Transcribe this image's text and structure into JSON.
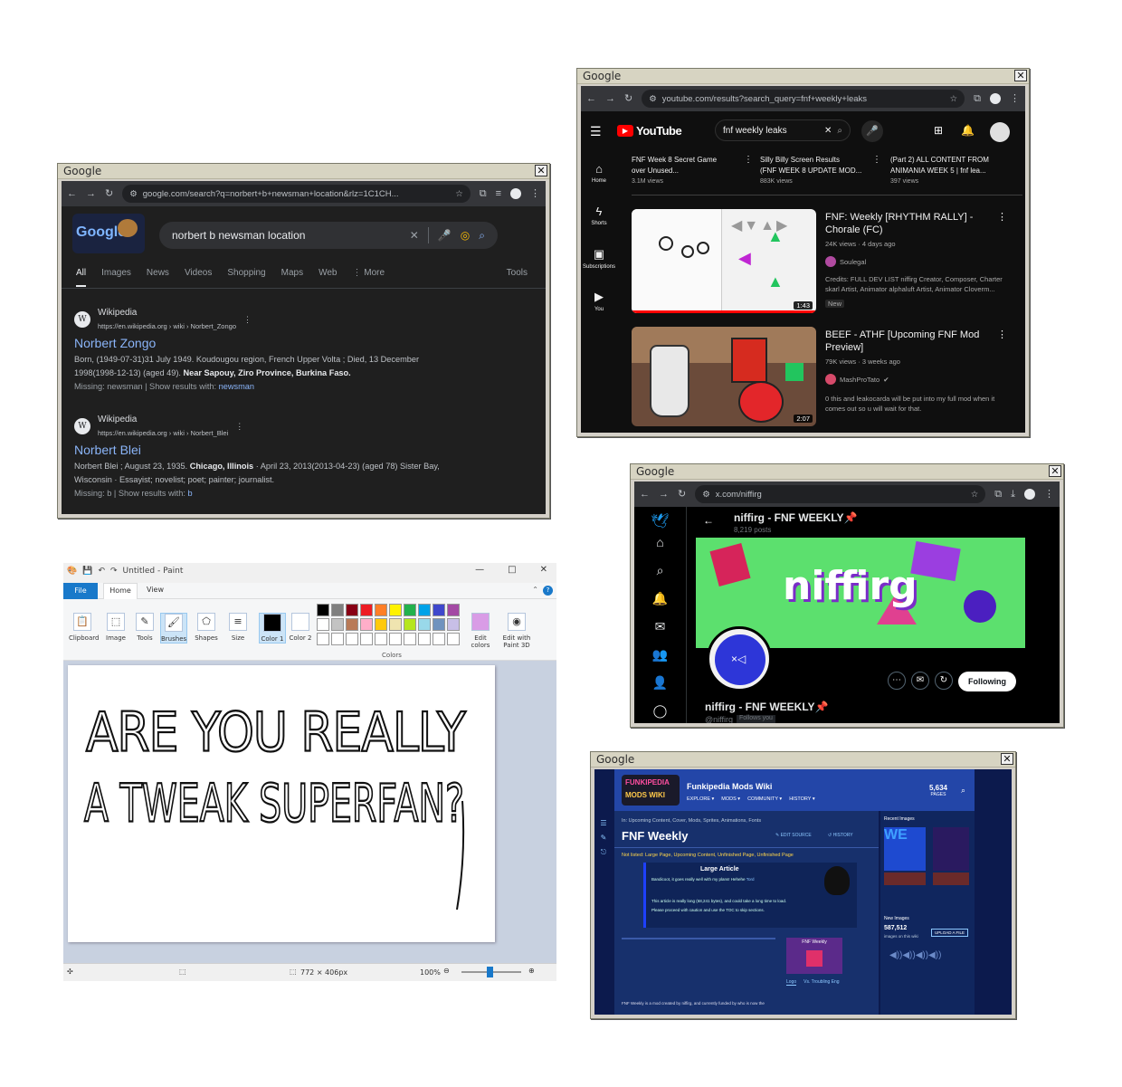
{
  "google_window": {
    "title": "Google",
    "url": "google.com/search?q=norbert+b+newsman+location&rlz=1C1CH...",
    "logo": "Google",
    "query": "norbert b newsman location",
    "tabs": [
      "All",
      "Images",
      "News",
      "Videos",
      "Shopping",
      "Maps",
      "Web",
      "More"
    ],
    "tools": "Tools",
    "results": [
      {
        "site": "Wikipedia",
        "url": "https://en.wikipedia.org › wiki › Norbert_Zongo",
        "title": "Norbert Zongo",
        "snippet1": "Born, (1949-07-31)31 July 1949. Koudougou region, French Upper Volta ; Died, 13 December",
        "snippet2a": "1998(1998-12-13) (aged 49). ",
        "snippet2b": "Near Sapouy, Ziro Province, Burkina Faso.",
        "missing": "Missing: newsman | Show results with: ",
        "missing_link": "newsman"
      },
      {
        "site": "Wikipedia",
        "url": "https://en.wikipedia.org › wiki › Norbert_Blei",
        "title": "Norbert Blei",
        "snippet1a": "Norbert Blei ; August 23, 1935. ",
        "snippet1b": "Chicago, Illinois",
        "snippet1c": " · April 23, 2013(2013-04-23) (aged 78) Sister Bay,",
        "snippet2": "Wisconsin · Essayist; novelist; poet; painter; journalist.",
        "missing": "Missing: b | Show results with: ",
        "missing_link": "b"
      }
    ]
  },
  "youtube_window": {
    "title": "Google",
    "url": "youtube.com/results?search_query=fnf+weekly+leaks",
    "brand": "YouTube",
    "query": "fnf weekly leaks",
    "sidebar": [
      "Home",
      "Shorts",
      "Subscriptions",
      "You"
    ],
    "top_videos": [
      {
        "title1": "FNF Week 8 Secret Game",
        "title2": "over Unused...",
        "meta": "3.1M views"
      },
      {
        "title1": "Silly Billy Screen Results",
        "title2": "(FNF WEEK 8 UPDATE MOD...",
        "meta": "883K views"
      },
      {
        "title1": "(Part 2) ALL CONTENT FROM",
        "title2": "ANIMANIA WEEK 5 | fnf lea...",
        "meta": "397 views"
      }
    ],
    "videos": [
      {
        "title1": "FNF: Weekly [RHYTHM RALLY] -",
        "title2": "Chorale (FC)",
        "meta": "24K views · 4 days ago",
        "channel": "Soulegal",
        "desc1": "Credits: FULL DEV LIST niffirg Creator, Composer, Charter",
        "desc2": "skarl Artist, Animator alphaluft Artist, Animator Cloverm...",
        "badge": "New",
        "duration": "1:43"
      },
      {
        "title1": "BEEF - ATHF [Upcoming FNF Mod",
        "title2": "Preview]",
        "meta": "79K views · 3 weeks ago",
        "channel": "MashProTato",
        "desc1": "0 this and leakocarda will be put into my full mod when it",
        "desc2": "comes out so u will wait for that.",
        "duration": "2:07"
      }
    ]
  },
  "twitter_window": {
    "title": "Google",
    "url": "x.com/niffirg",
    "name": "niffirg - FNF WEEKLY📌",
    "posts": "8,219 posts",
    "banner_text": "niffirg",
    "handle": "@niffirg",
    "follows_you": "Follows you",
    "following": "Following"
  },
  "fandom_window": {
    "title": "Google",
    "wiki_name": "Funkipedia Mods Wiki",
    "logo_text1": "FUNKIPEDIA",
    "logo_text2": "MODS WIKI",
    "nav": [
      "EXPLORE ▾",
      "MODS ▾",
      "COMMUNITY ▾",
      "HISTORY ▾"
    ],
    "pages_count": "5,634",
    "pages_label": "PAGES",
    "breadcrumb": "In: Upcoming Content, Cover, Mods, Sprites, Animations, Fonts",
    "page_title": "FNF Weekly",
    "edit": "EDIT SOURCE",
    "history": "HISTORY",
    "hatnote": "Not listed: Large Page, Upcoming Content, Unfinished Page, Unfinished Page",
    "box_title": "Large Article",
    "box_line1": "Bandicoot, it goes really well with my plans! Hehehe",
    "box_author": "Tord",
    "box_line2": "This article is really long (68,241 bytes), and could take a long time to load.",
    "box_line3": "Please proceed with caution and use the TOC to skip sections.",
    "infobox_title": "FNF Weekly",
    "tab1": "Logo",
    "tab2": "Vs. Troubling Eng",
    "body_line1": "FNF Weekly is a mod created by niffirg, and currently funded by who is now the",
    "recent_images": "Recent Images",
    "new_images": "New Images",
    "new_images_count": "587,512",
    "new_images_sub": "images on this wiki",
    "view_all": "UPLOAD A FILE"
  },
  "paint_window": {
    "title": "Untitled - Paint",
    "tabs": [
      "File",
      "Home",
      "View"
    ],
    "tools": [
      "Clipboard",
      "Image",
      "Tools",
      "Brushes",
      "Shapes",
      "Size",
      "Color 1",
      "Color 2",
      "Edit colors",
      "Edit with Paint 3D"
    ],
    "colors_label": "Colors",
    "canvas_line1": "ARE YOU REALLY",
    "canvas_line2": "A TWEAK SUPERFAN?",
    "status_size": "772 × 406px",
    "zoom": "100%",
    "palette": [
      "#000000",
      "#7f7f7f",
      "#880015",
      "#ed1c24",
      "#ff7f27",
      "#fff200",
      "#22b14c",
      "#00a2e8",
      "#3f48cc",
      "#a349a4",
      "#ffffff",
      "#c3c3c3",
      "#b97a57",
      "#ffaec9",
      "#ffc90e",
      "#efe4b0",
      "#b5e61d",
      "#99d9ea",
      "#7092be",
      "#c8bfe7"
    ]
  }
}
